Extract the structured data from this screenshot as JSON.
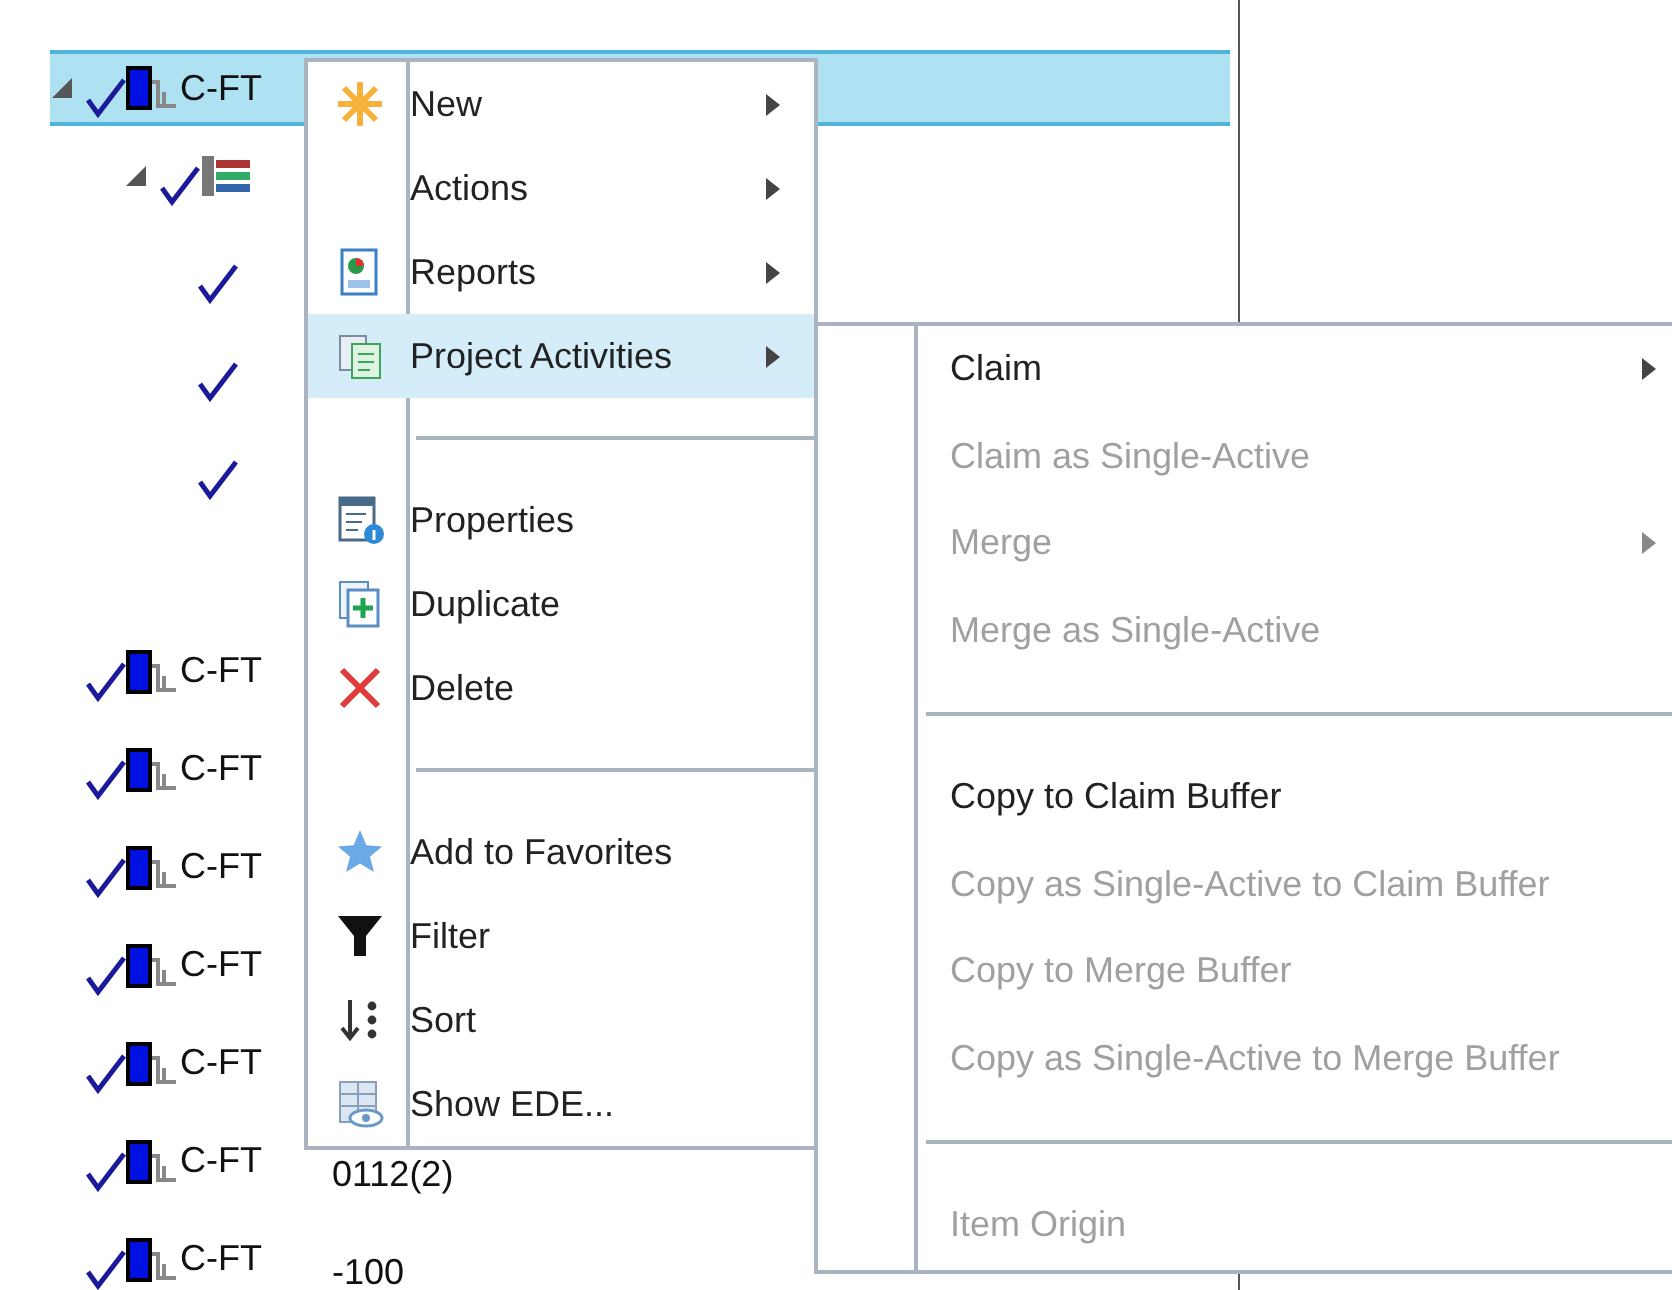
{
  "tree": [
    {
      "label": "C-FT",
      "selected": true,
      "expanded": true,
      "checked": true,
      "children": [
        {
          "selected": false,
          "expanded": true,
          "checked": true,
          "children": [
            {
              "selected": false,
              "checked": true
            },
            {
              "selected": false,
              "checked": true
            },
            {
              "selected": false,
              "checked": true
            }
          ]
        }
      ]
    },
    {
      "label": "C-FT",
      "selected": false,
      "checked": true
    },
    {
      "label": "C-FT",
      "selected": false,
      "checked": true
    },
    {
      "label": "C-FT",
      "selected": false,
      "checked": true
    },
    {
      "label": "C-FT",
      "selected": false,
      "checked": true
    },
    {
      "label": "C-FT",
      "selected": false,
      "checked": true
    },
    {
      "label": "C-FT",
      "detail": "0112(2)",
      "selected": false,
      "checked": true
    },
    {
      "label": "C-FT",
      "detail": "-100",
      "selected": false,
      "checked": true
    }
  ],
  "context_menu": {
    "items": [
      {
        "kind": "item",
        "label": "New",
        "submenu": true,
        "selected": false,
        "disabled": false
      },
      {
        "kind": "item",
        "label": "Actions",
        "submenu": true,
        "selected": false,
        "disabled": false
      },
      {
        "kind": "item",
        "label": "Reports",
        "submenu": true,
        "selected": false,
        "disabled": false
      },
      {
        "kind": "item",
        "label": "Project Activities",
        "submenu": true,
        "selected": true,
        "disabled": false
      },
      {
        "kind": "separator"
      },
      {
        "kind": "item",
        "label": "Properties",
        "submenu": false,
        "selected": false,
        "disabled": false
      },
      {
        "kind": "item",
        "label": "Duplicate",
        "submenu": false,
        "selected": false,
        "disabled": false
      },
      {
        "kind": "item",
        "label": "Delete",
        "submenu": false,
        "selected": false,
        "disabled": false
      },
      {
        "kind": "separator"
      },
      {
        "kind": "item",
        "label": "Add to Favorites",
        "submenu": false,
        "selected": false,
        "disabled": false
      },
      {
        "kind": "item",
        "label": "Filter",
        "submenu": false,
        "selected": false,
        "disabled": false
      },
      {
        "kind": "item",
        "label": "Sort",
        "submenu": false,
        "selected": false,
        "disabled": false
      },
      {
        "kind": "item",
        "label": "Show EDE...",
        "submenu": false,
        "selected": false,
        "disabled": false
      }
    ]
  },
  "submenu": {
    "items": [
      {
        "kind": "item",
        "label": "Claim",
        "submenu": true,
        "selected": false,
        "disabled": false
      },
      {
        "kind": "item",
        "label": "Claim as Single-Active",
        "submenu": false,
        "selected": false,
        "disabled": true
      },
      {
        "kind": "item",
        "label": "Merge",
        "submenu": true,
        "selected": false,
        "disabled": true
      },
      {
        "kind": "item",
        "label": "Merge as Single-Active",
        "submenu": false,
        "selected": false,
        "disabled": true
      },
      {
        "kind": "separator"
      },
      {
        "kind": "item",
        "label": "Copy to Claim Buffer",
        "submenu": false,
        "selected": false,
        "disabled": false
      },
      {
        "kind": "item",
        "label": "Copy as Single-Active to Claim Buffer",
        "submenu": false,
        "selected": false,
        "disabled": true
      },
      {
        "kind": "item",
        "label": "Copy to Merge Buffer",
        "submenu": false,
        "selected": false,
        "disabled": true
      },
      {
        "kind": "item",
        "label": "Copy as Single-Active to Merge Buffer",
        "submenu": false,
        "selected": false,
        "disabled": true
      },
      {
        "kind": "separator"
      },
      {
        "kind": "item",
        "label": "Item Origin",
        "submenu": false,
        "selected": false,
        "disabled": true
      }
    ]
  }
}
